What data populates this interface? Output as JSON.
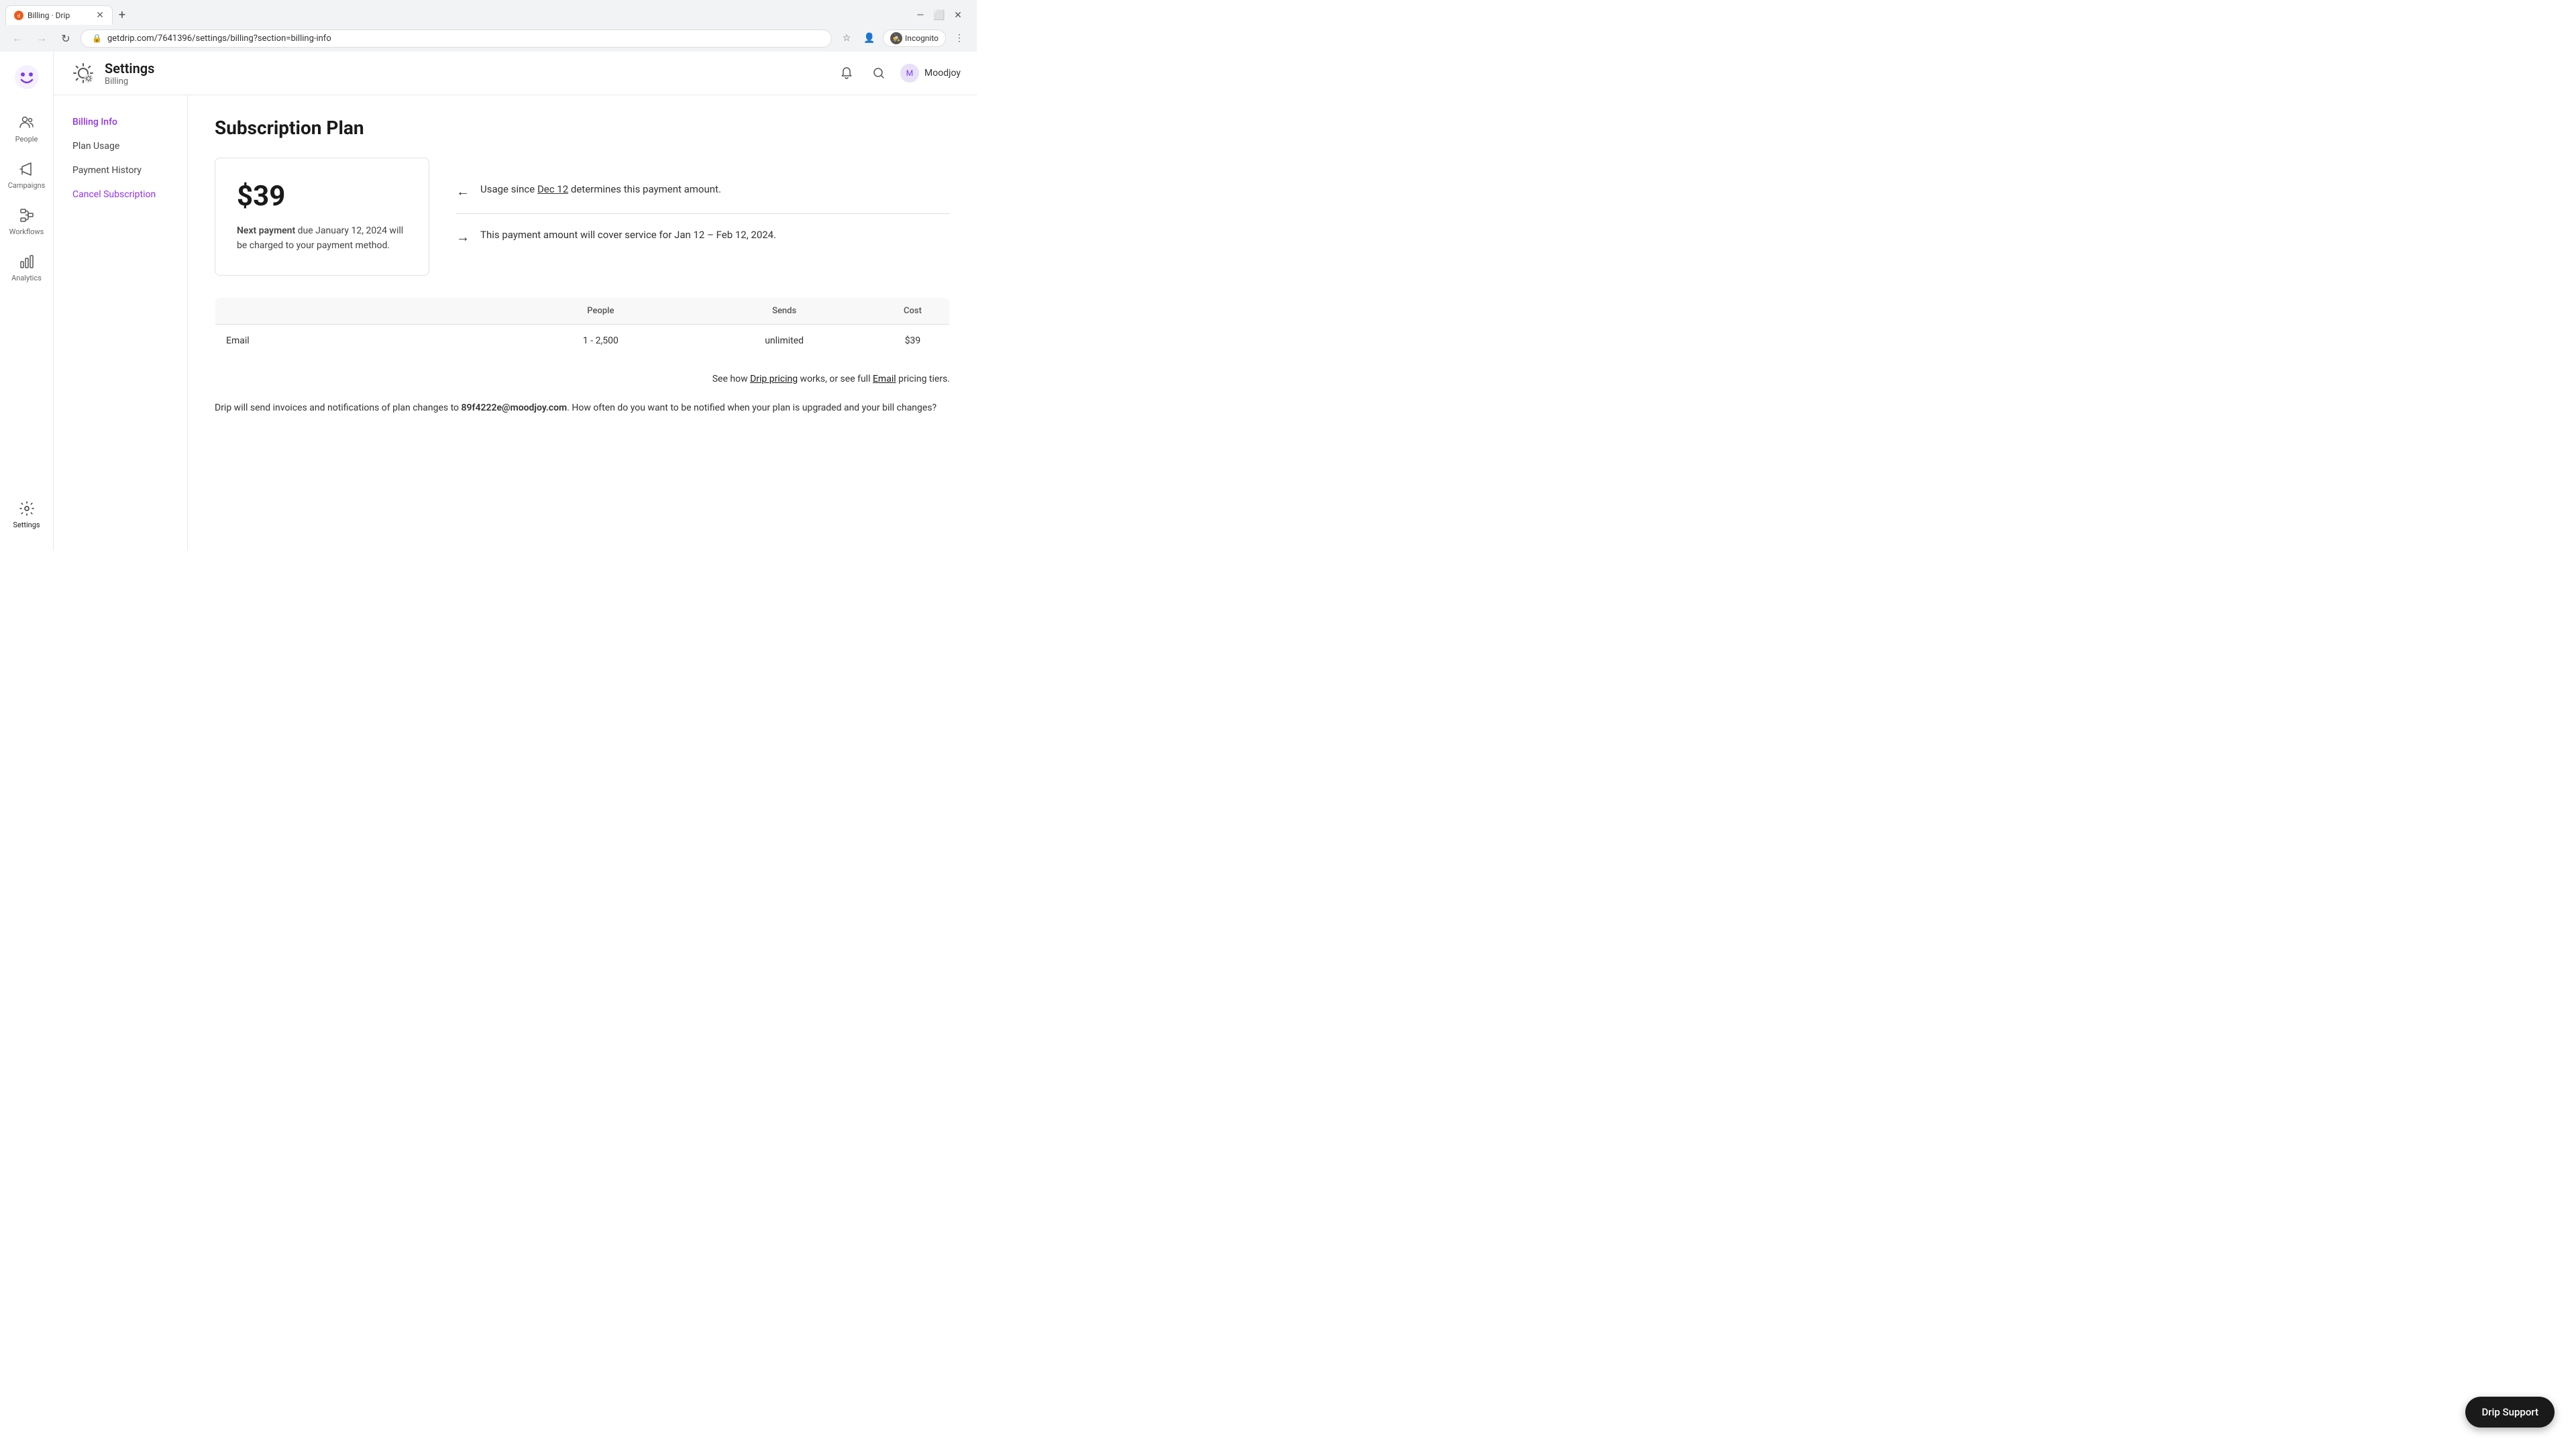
{
  "browser": {
    "tab_title": "Billing · Drip",
    "url": "getdrip.com/7641396/settings/billing?section=billing-info",
    "incognito_label": "Incognito"
  },
  "header": {
    "settings_label": "Settings",
    "billing_label": "Billing",
    "user_name": "Moodjoy"
  },
  "settings_sidebar": {
    "items": [
      {
        "id": "billing-info",
        "label": "Billing Info",
        "active": true
      },
      {
        "id": "plan-usage",
        "label": "Plan Usage",
        "active": false
      },
      {
        "id": "payment-history",
        "label": "Payment History",
        "active": false
      },
      {
        "id": "cancel-subscription",
        "label": "Cancel Subscription",
        "active": false,
        "cancel": true
      }
    ]
  },
  "left_nav": {
    "items": [
      {
        "id": "people",
        "label": "People",
        "icon": "👥"
      },
      {
        "id": "campaigns",
        "label": "Campaigns",
        "icon": "📢"
      },
      {
        "id": "workflows",
        "label": "Workflows",
        "icon": "⚡"
      },
      {
        "id": "analytics",
        "label": "Analytics",
        "icon": "📊"
      }
    ],
    "settings_label": "Settings"
  },
  "page": {
    "title": "Subscription Plan",
    "price": "$39",
    "payment_info": {
      "prefix": "Next payment",
      "detail": " due January 12, 2024 will be charged to your payment method."
    },
    "arrow_left": {
      "text_1": "Usage since ",
      "link": "Dec 12",
      "text_2": " determines this payment amount."
    },
    "arrow_right": {
      "text": "This payment amount will cover service for Jan 12 – Feb 12, 2024."
    },
    "table": {
      "headers": [
        "",
        "People",
        "Sends",
        "Cost"
      ],
      "rows": [
        {
          "type": "Email",
          "people": "1 - 2,500",
          "sends": "unlimited",
          "cost": "$39"
        }
      ]
    },
    "pricing_text": {
      "prefix": "See how ",
      "drip_pricing_link": "Drip pricing",
      "middle": " works, or see full ",
      "email_link": "Email",
      "suffix": " pricing tiers."
    },
    "invoice_text": {
      "prefix": "Drip will send invoices and notifications of plan changes to ",
      "email": "89f4222e@moodjoy.com",
      "suffix": ". How often do you want to be notified when your plan is upgraded and your bill changes?"
    }
  },
  "drip_support": {
    "label": "Drip Support"
  }
}
